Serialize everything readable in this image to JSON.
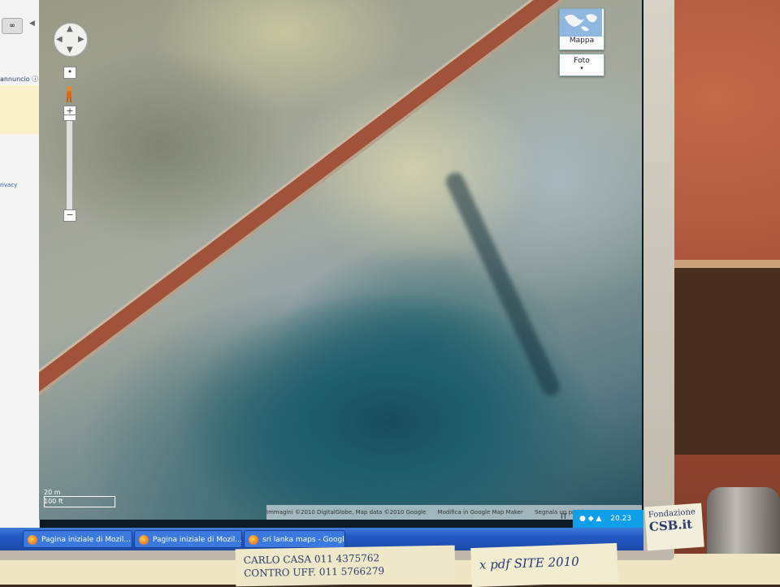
{
  "sidebar": {
    "link_button": "∞",
    "ad_label": "annuncio",
    "privacy_label": "rivacy"
  },
  "map": {
    "controls": {
      "zoom_in": "+",
      "zoom_out": "−"
    },
    "map_type": {
      "map_label": "Mappa",
      "photo_label": "Foto",
      "photo_arrow": "▾"
    },
    "scale": {
      "metric": "20 m",
      "imperial": "100 ft"
    },
    "footer": {
      "imagery_credit": "Immagini ©2010 DigitalGlobe, Map data ©2010 Google",
      "edit_link": "Modifica in Google Map Maker",
      "report_link": "Segnala un problema",
      "close": "✕"
    }
  },
  "taskbar": {
    "tasks": [
      {
        "label": "Pagina iniziale di Mozil..."
      },
      {
        "label": "Pagina iniziale di Mozil..."
      },
      {
        "label": "sri lanka maps - Googl..."
      }
    ],
    "language": "IT",
    "clock": "20.23"
  },
  "desk_notes": {
    "note1_line1": "CARLO CASA 011 4375762",
    "note1_line2": "CONTRO UFF. 011 5766279",
    "note2": "x pdf      SITE 2010",
    "note3_line1": "Fondazione",
    "note3_line2": "CSB.it"
  },
  "colors": {
    "taskbar": "#2459c4",
    "road": "#a0533a",
    "water": "#1f5e6c"
  }
}
